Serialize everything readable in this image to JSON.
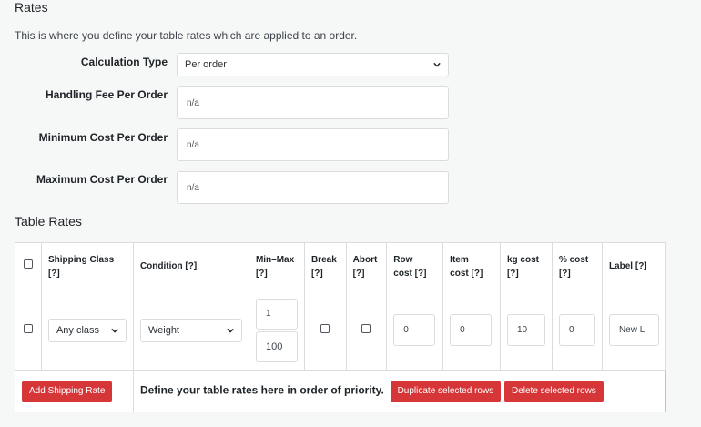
{
  "rates_section": {
    "heading": "Rates",
    "description": "This is where you define your table rates which are applied to an order.",
    "calculation_type": {
      "label": "Calculation Type",
      "value": "Per order"
    },
    "handling_fee": {
      "label": "Handling Fee Per Order",
      "placeholder": "n/a"
    },
    "minimum_cost": {
      "label": "Minimum Cost Per Order",
      "placeholder": "n/a"
    },
    "maximum_cost": {
      "label": "Maximum Cost Per Order",
      "placeholder": "n/a"
    }
  },
  "table_rates": {
    "heading": "Table Rates",
    "columns": {
      "shipping_class": "Shipping Class",
      "condition": "Condition",
      "min_max": "Min–Max",
      "break": "Break",
      "abort": "Abort",
      "row_cost_a": "Row",
      "row_cost_b": "cost",
      "item_cost_a": "Item",
      "item_cost_b": "cost",
      "kg_cost": "kg cost",
      "pct_cost": "% cost",
      "label": "Label",
      "help": "[?]"
    },
    "row": {
      "shipping_class": "Any class",
      "condition": "Weight",
      "min": "1",
      "max": "100",
      "row_cost": "0",
      "item_cost": "0",
      "kg_cost": "10",
      "pct_cost": "0",
      "label": "New L"
    },
    "footer": {
      "add_button": "Add Shipping Rate",
      "hint": "Define your table rates here in order of priority.",
      "duplicate_button": "Duplicate selected rows",
      "delete_button": "Delete selected rows"
    }
  }
}
